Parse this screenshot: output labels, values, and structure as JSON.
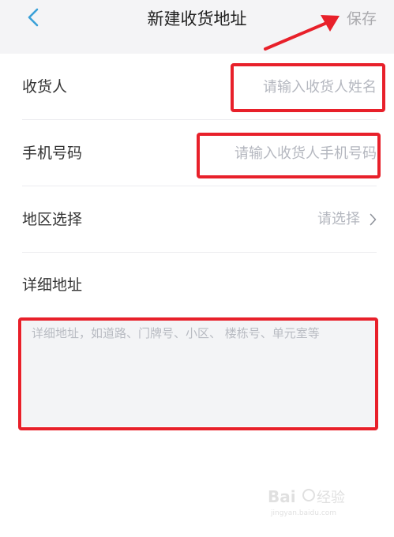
{
  "header": {
    "title": "新建收货地址",
    "save_label": "保存"
  },
  "form": {
    "recipient": {
      "label": "收货人",
      "placeholder": "请输入收货人姓名",
      "value": ""
    },
    "phone": {
      "label": "手机号码",
      "placeholder": "请输入收货人手机号码",
      "value": ""
    },
    "region": {
      "label": "地区选择",
      "value": "请选择"
    },
    "detail": {
      "label": "详细地址",
      "placeholder": "详细地址，如道路、门牌号、小区、 楼栋号、单元室等",
      "value": ""
    }
  },
  "colors": {
    "accent": "#3aa0d8",
    "header_bg": "#f4f4f6",
    "placeholder": "#b4b7bf",
    "annotation": "#e8202a"
  },
  "icons": {
    "back": "chevron-left-icon",
    "region": "chevron-right-icon"
  },
  "watermark": {
    "text": "Bai 经验",
    "url": "jingyan.baidu.com"
  }
}
